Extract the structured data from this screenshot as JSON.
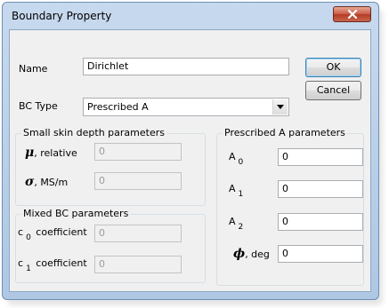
{
  "window": {
    "title": "Boundary Property"
  },
  "name_field": {
    "label": "Name",
    "value": "Dirichlet"
  },
  "bc_type": {
    "label": "BC Type",
    "selected": "Prescribed A"
  },
  "buttons": {
    "ok": "OK",
    "cancel": "Cancel"
  },
  "skin_depth": {
    "title": "Small skin depth parameters",
    "mu_symbol": "μ",
    "mu_label": ", relative",
    "mu_value": "0",
    "sigma_symbol": "σ",
    "sigma_label": ", MS/m",
    "sigma_value": "0"
  },
  "mixed_bc": {
    "title": "Mixed BC parameters",
    "c0_letter": "c",
    "c0_sub": "0",
    "c0_label": "coefficient",
    "c0_value": "0",
    "c1_letter": "c",
    "c1_sub": "1",
    "c1_label": "coefficient",
    "c1_value": "0"
  },
  "prescribed_a": {
    "title": "Prescribed A parameters",
    "a0_letter": "A",
    "a0_sub": "0",
    "a0_value": "0",
    "a1_letter": "A",
    "a1_sub": "1",
    "a1_value": "0",
    "a2_letter": "A",
    "a2_sub": "2",
    "a2_value": "0",
    "phi_symbol": "ϕ",
    "phi_label": ", deg",
    "phi_value": "0"
  },
  "icons": {
    "close": "close-icon",
    "dropdown": "chevron-down-icon"
  }
}
